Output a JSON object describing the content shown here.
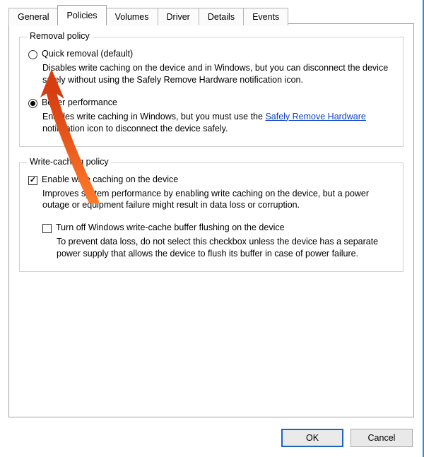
{
  "tabs": {
    "general": "General",
    "policies": "Policies",
    "volumes": "Volumes",
    "driver": "Driver",
    "details": "Details",
    "events": "Events"
  },
  "removal": {
    "legend": "Removal policy",
    "quick": {
      "label": "Quick removal (default)",
      "desc_before": "Disables write caching on the device and in Windows, but you can disconnect the device safely without using the Safely Remove Hardware notification icon."
    },
    "better": {
      "label": "Better performance",
      "desc_before": "Enables write caching in Windows, but you must use the ",
      "desc_link": "Safely Remove Hardware",
      "desc_after": " notification icon to disconnect the device safely."
    }
  },
  "caching": {
    "legend": "Write-caching policy",
    "enable": {
      "label": "Enable write caching on the device",
      "desc": "Improves system performance by enabling write caching on the device, but a power outage or equipment failure might result in data loss or corruption."
    },
    "flush": {
      "label": "Turn off Windows write-cache buffer flushing on the device",
      "desc": "To prevent data loss, do not select this checkbox unless the device has a separate power supply that allows the device to flush its buffer in case of power failure."
    }
  },
  "buttons": {
    "ok": "OK",
    "cancel": "Cancel"
  }
}
